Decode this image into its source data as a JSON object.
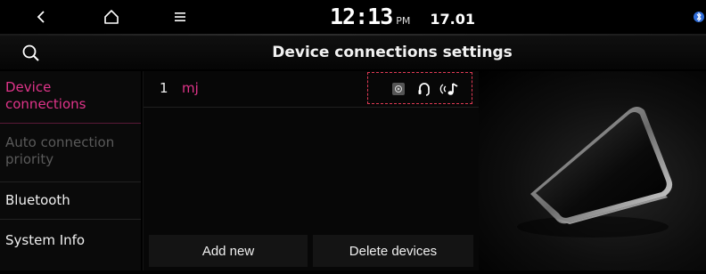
{
  "status_bar": {
    "time": "12:13",
    "ampm": "PM",
    "date": "17.01"
  },
  "header": {
    "title": "Device connections settings"
  },
  "sidebar": {
    "items": [
      {
        "label": "Device connections",
        "state": "active"
      },
      {
        "label": "Auto connection priority",
        "state": "disabled"
      },
      {
        "label": "Bluetooth",
        "state": "normal"
      },
      {
        "label": "System Info",
        "state": "normal"
      }
    ]
  },
  "devices": [
    {
      "index": "1",
      "name": "mj",
      "profile_icons": [
        "projection-icon",
        "headset-icon",
        "bluetooth-audio-icon"
      ]
    }
  ],
  "actions": {
    "add_label": "Add new",
    "delete_label": "Delete devices"
  },
  "colors": {
    "accent": "#e0348a",
    "highlight_border": "#e03a55",
    "disabled_text": "#5a5a5a"
  }
}
